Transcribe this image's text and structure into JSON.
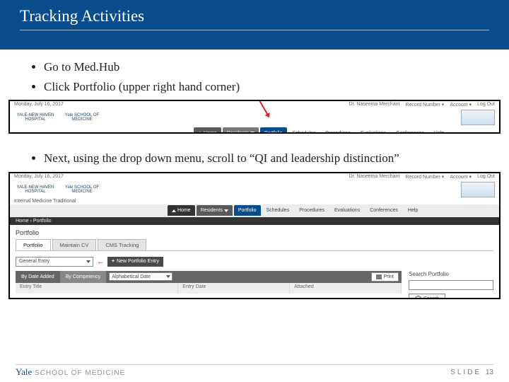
{
  "title": "Tracking Activities",
  "bullets1": {
    "a": "Go to Med.Hub",
    "b": "Click Portfolio (upper right hand corner)"
  },
  "bullets2": {
    "a": "Next, using the drop down menu, scroll to “QI and leadership distinction”"
  },
  "shot_top": {
    "date": "Monday, July 16, 2017",
    "user": "Dr. Naseema Merchant",
    "record": "Record Number ▾",
    "account": "Account ▾",
    "logout": "Log Out",
    "hosp": "YALE-NEW HAVEN HOSPITAL",
    "ysm": "Yale SCHOOL OF MEDICINE",
    "dept": "Internal Medicine Traditional"
  },
  "nav": {
    "home": "Home",
    "residents": "Residents",
    "portfolio": "Portfolio",
    "schedules": "Schedules",
    "procedures": "Procedures",
    "evaluations": "Evaluations",
    "conferences": "Conferences",
    "help": "Help"
  },
  "shot_bottom": {
    "crumb": "Home › Portfolio",
    "panel": "Portfolio",
    "tab1": "Portfolio",
    "tab2": "Maintain CV",
    "tab3": "CMS Tracking",
    "select": "General Entry",
    "newbtn": "New Portfolio Entry",
    "tb1": "By Date Added",
    "tb2": "By Competency",
    "sort": "Alphabetical Date",
    "print": "Print",
    "col1": "Entry Title",
    "col2": "Entry Date",
    "col3": "Attached",
    "sp": "Search Portfolio",
    "search": "Search"
  },
  "footer": {
    "yale": "Yale",
    "som": " SCHOOL OF MEDICINE",
    "slide": "SLIDE",
    "num": "13"
  }
}
